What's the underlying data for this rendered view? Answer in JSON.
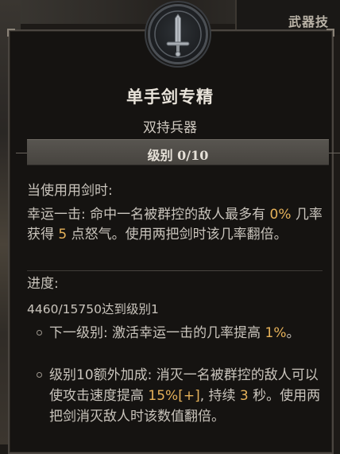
{
  "background": {
    "corner_label": "武器技"
  },
  "tooltip": {
    "icon": "sword-icon",
    "title": "单手剑专精",
    "subtitle": "双持兵器",
    "rank_label": "级别 0/10",
    "condition_heading": "当使用用剑时:",
    "effect": {
      "part1": "幸运一击: 命中一名被群控的敌人最多有 ",
      "value_percent": "0%",
      "part2": " 几率获得 ",
      "value_fury": "5",
      "part3": " 点怒气。使用两把剑时该几率翻倍。"
    },
    "progress": {
      "heading": "进度:",
      "value": "4460/15750达到级别1"
    },
    "next_rank": {
      "part1": "下一级别: 激活幸运一击的几率提高 ",
      "value": "1%",
      "part2": "。"
    },
    "bonus": {
      "part1": "级别10额外加成: 消灭一名被群控的敌人可以使攻击速度提高 ",
      "value_speed": "15%[+]",
      "part2": ", 持续 ",
      "value_duration": "3",
      "part3": " 秒。使用两把剑消灭敌人时该数值翻倍。"
    }
  },
  "colors": {
    "highlight": "#e6b25a",
    "text": "#c9c4bc",
    "title": "#e8e3da",
    "panel_bg": "#151311"
  }
}
